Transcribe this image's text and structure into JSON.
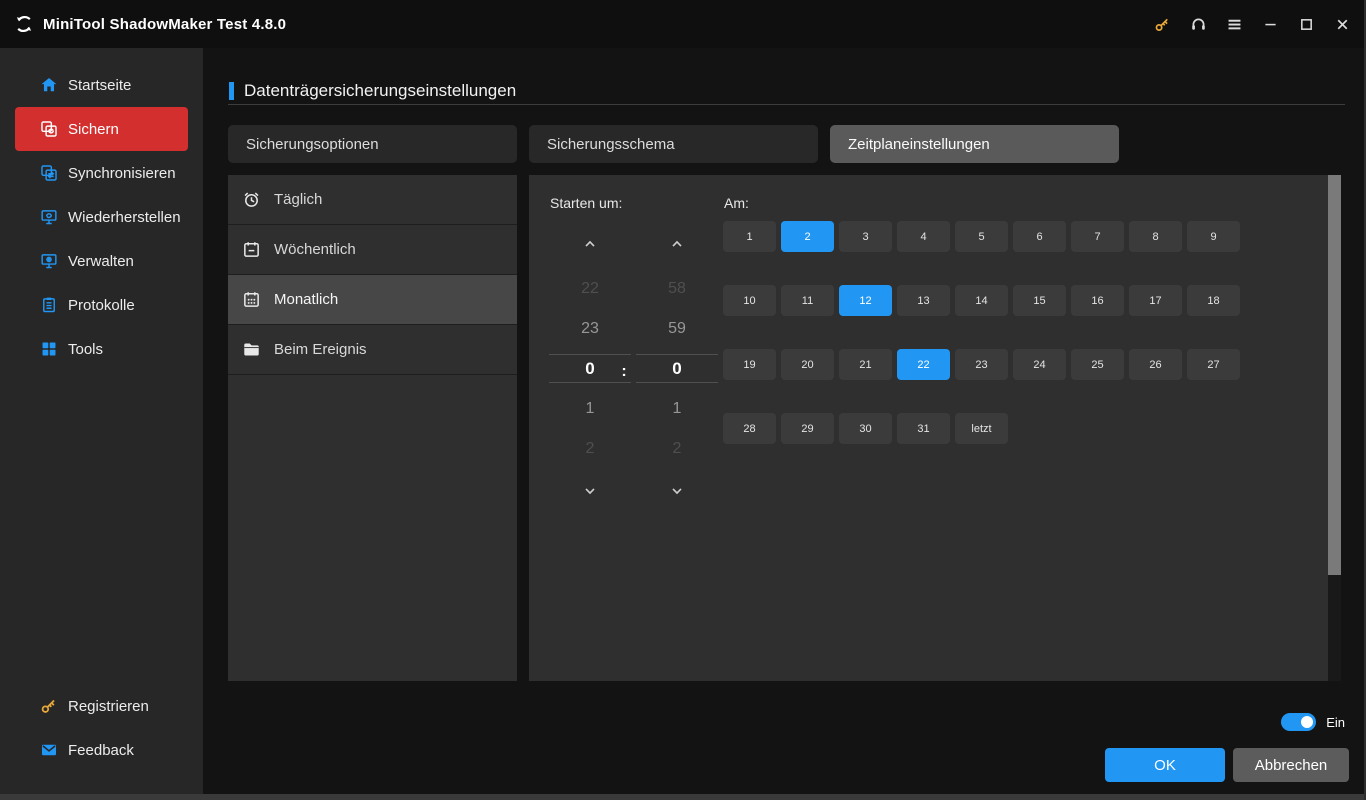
{
  "titlebar": {
    "title": "MiniTool ShadowMaker Test 4.8.0",
    "action_icons": [
      "key-icon",
      "headset-icon",
      "menu-icon",
      "minimize-icon",
      "maximize-icon",
      "close-icon"
    ]
  },
  "sidebar": {
    "items": [
      {
        "label": "Startseite",
        "icon": "home-icon",
        "active": false
      },
      {
        "label": "Sichern",
        "icon": "backup-icon",
        "active": true
      },
      {
        "label": "Synchronisieren",
        "icon": "sync-icon",
        "active": false
      },
      {
        "label": "Wiederherstellen",
        "icon": "restore-icon",
        "active": false
      },
      {
        "label": "Verwalten",
        "icon": "manage-icon",
        "active": false
      },
      {
        "label": "Protokolle",
        "icon": "logs-icon",
        "active": false
      },
      {
        "label": "Tools",
        "icon": "tools-icon",
        "active": false
      }
    ],
    "bottom_items": [
      {
        "label": "Registrieren",
        "icon": "key-icon",
        "color": "yellow"
      },
      {
        "label": "Feedback",
        "icon": "mail-icon",
        "color": "blue"
      }
    ]
  },
  "page": {
    "title": "Datenträgersicherungseinstellungen"
  },
  "tabs": [
    {
      "label": "Sicherungsoptionen",
      "active": false
    },
    {
      "label": "Sicherungsschema",
      "active": false
    },
    {
      "label": "Zeitplaneinstellungen",
      "active": true
    }
  ],
  "schedule": {
    "frequencies": [
      {
        "label": "Täglich",
        "icon": "alarm-clock-icon",
        "selected": false
      },
      {
        "label": "Wöchentlich",
        "icon": "calendar-week-icon",
        "selected": false
      },
      {
        "label": "Monatlich",
        "icon": "calendar-month-icon",
        "selected": true
      },
      {
        "label": "Beim Ereignis",
        "icon": "folder-icon",
        "selected": false
      }
    ],
    "start_time": {
      "label": "Starten um:",
      "separator": ":",
      "hour_values": [
        "22",
        "23",
        "0",
        "1",
        "2"
      ],
      "minute_values": [
        "58",
        "59",
        "0",
        "1",
        "2"
      ],
      "selected_hour": "0",
      "selected_minute": "0"
    },
    "days": {
      "label": "Am:",
      "items": [
        "1",
        "2",
        "3",
        "4",
        "5",
        "6",
        "7",
        "8",
        "9",
        "10",
        "11",
        "12",
        "13",
        "14",
        "15",
        "16",
        "17",
        "18",
        "19",
        "20",
        "21",
        "22",
        "23",
        "24",
        "25",
        "26",
        "27",
        "28",
        "29",
        "30",
        "31",
        "letzt"
      ],
      "selected": [
        "2",
        "12",
        "22"
      ]
    }
  },
  "footer": {
    "toggle_on": true,
    "toggle_state_label": "Ein",
    "ok_label": "OK",
    "cancel_label": "Abbrechen"
  },
  "colors": {
    "accent_blue": "#2196f3",
    "accent_red": "#d32f2f",
    "key_yellow": "#e9a83a"
  }
}
